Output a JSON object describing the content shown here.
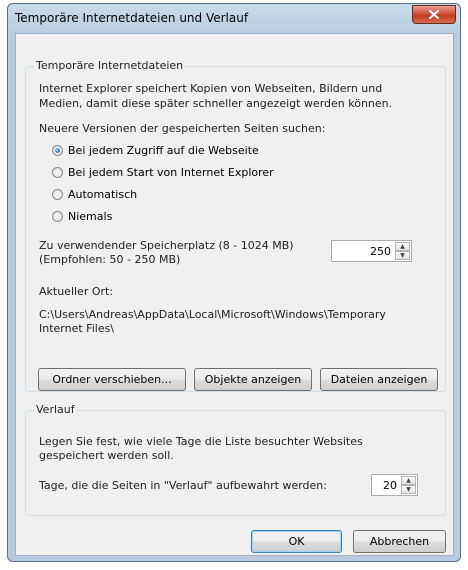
{
  "window": {
    "title": "Temporäre Internetdateien und Verlauf",
    "close_glyph": "x"
  },
  "temp_files": {
    "group_title": "Temporäre Internetdateien",
    "description_line1": "Internet Explorer speichert Kopien von Webseiten, Bildern und",
    "description_line2": "Medien, damit diese später schneller angezeigt werden können.",
    "check_label": "Neuere Versionen der gespeicherten Seiten suchen:",
    "options": [
      {
        "label": "Bei jedem Zugriff auf die Webseite",
        "checked": true
      },
      {
        "label": "Bei jedem Start von Internet Explorer",
        "checked": false
      },
      {
        "label": "Automatisch",
        "checked": false
      },
      {
        "label": "Niemals",
        "checked": false
      }
    ],
    "disk_space_label_line1": "Zu verwendender Speicherplatz (8 - 1024 MB)",
    "disk_space_label_line2": "(Empfohlen: 50 - 250 MB)",
    "disk_space_value": "250",
    "location_label": "Aktueller Ort:",
    "location_path_line1": "C:\\Users\\Andreas\\AppData\\Local\\Microsoft\\Windows\\Temporary",
    "location_path_line2": "Internet Files\\",
    "move_folder_button": "Ordner verschieben...",
    "view_objects_button": "Objekte anzeigen",
    "view_files_button": "Dateien anzeigen"
  },
  "history": {
    "group_title": "Verlauf",
    "description_line1": "Legen Sie fest, wie viele Tage die Liste besuchter Websites",
    "description_line2": "gespeichert werden soll.",
    "days_label": "Tage, die die Seiten in \"Verlauf\" aufbewahrt werden:",
    "days_value": "20"
  },
  "footer": {
    "ok_button": "OK",
    "cancel_button": "Abbrechen"
  },
  "colors": {
    "title_bar": "#c9dcec",
    "close_button": "#c13a22",
    "client_bg": "#f0f0f0",
    "radio_selected": "#1d6fd1"
  }
}
